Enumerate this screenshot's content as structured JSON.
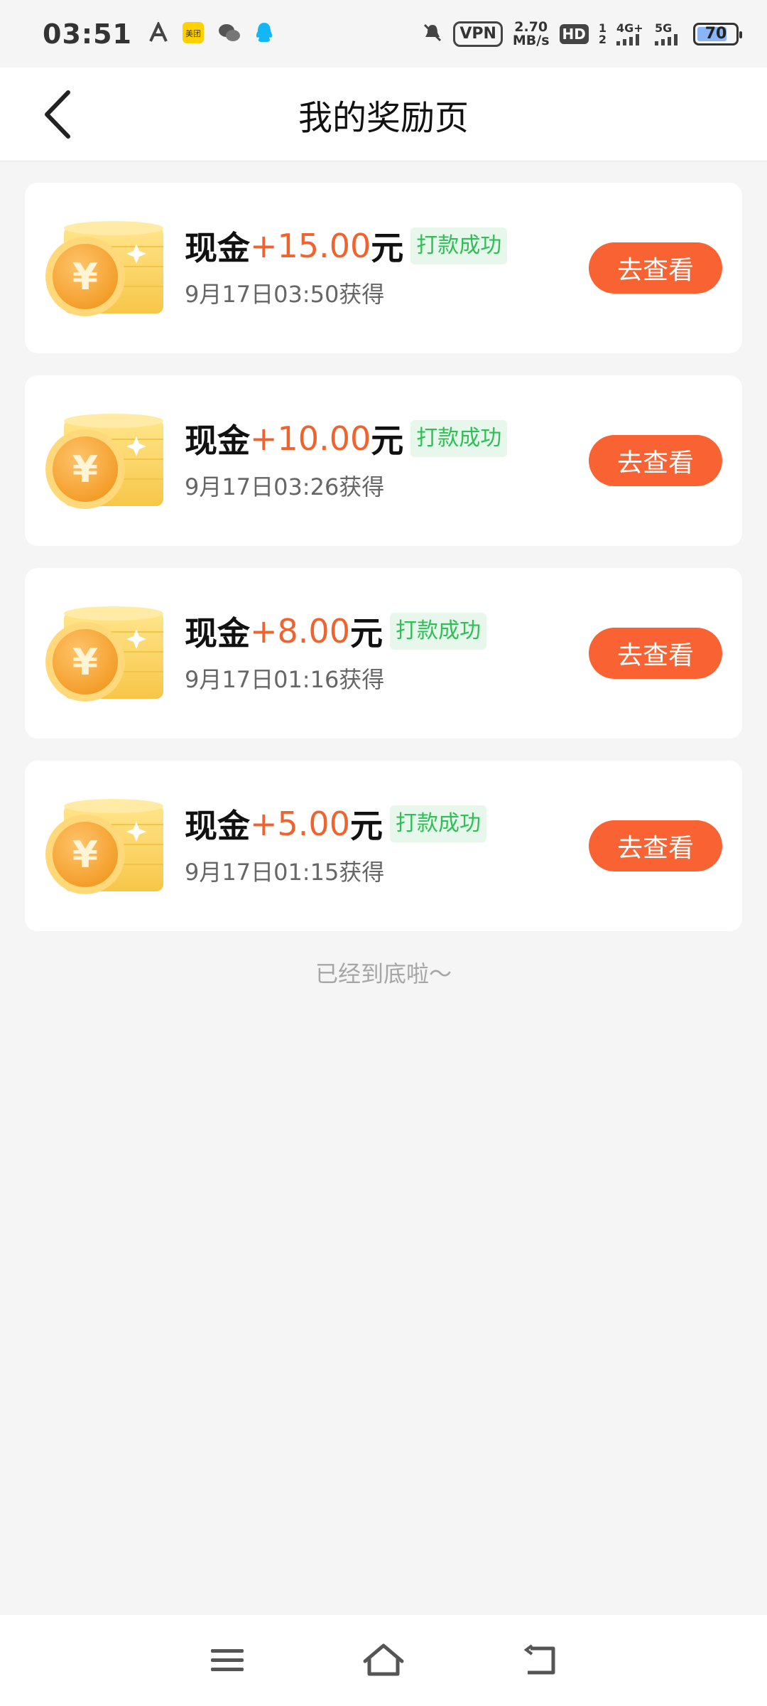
{
  "status_bar": {
    "time": "03:51",
    "meituan_label": "美团",
    "vpn": "VPN",
    "net_speed_value": "2.70",
    "net_speed_unit": "MB/s",
    "hd": "HD",
    "sim1": "1",
    "sim2": "2",
    "net1": "4G+",
    "net2": "5G",
    "battery": "70",
    "icons": [
      "font-a-icon",
      "meituan-icon",
      "wechat-icon",
      "qq-icon",
      "mute-icon",
      "signal-icon",
      "battery-icon"
    ]
  },
  "header": {
    "title": "我的奖励页",
    "back_icon": "chevron-left-icon"
  },
  "rewards": [
    {
      "prefix": "现金",
      "amount": "+15.00",
      "unit": "元",
      "status": "打款成功",
      "time": "9月17日03:50获得",
      "button": "去查看"
    },
    {
      "prefix": "现金",
      "amount": "+10.00",
      "unit": "元",
      "status": "打款成功",
      "time": "9月17日03:26获得",
      "button": "去查看"
    },
    {
      "prefix": "现金",
      "amount": "+8.00",
      "unit": "元",
      "status": "打款成功",
      "time": "9月17日01:16获得",
      "button": "去查看"
    },
    {
      "prefix": "现金",
      "amount": "+5.00",
      "unit": "元",
      "status": "打款成功",
      "time": "9月17日01:15获得",
      "button": "去查看"
    }
  ],
  "footer_text": "已经到底啦～",
  "nav_bar": {
    "icons": [
      "menu-icon",
      "home-icon",
      "back-icon"
    ]
  },
  "colors": {
    "accent": "#f96232",
    "amount": "#f0632f",
    "success_text": "#2fbf57",
    "success_bg": "#e8f7ec",
    "background": "#f5f5f5"
  }
}
